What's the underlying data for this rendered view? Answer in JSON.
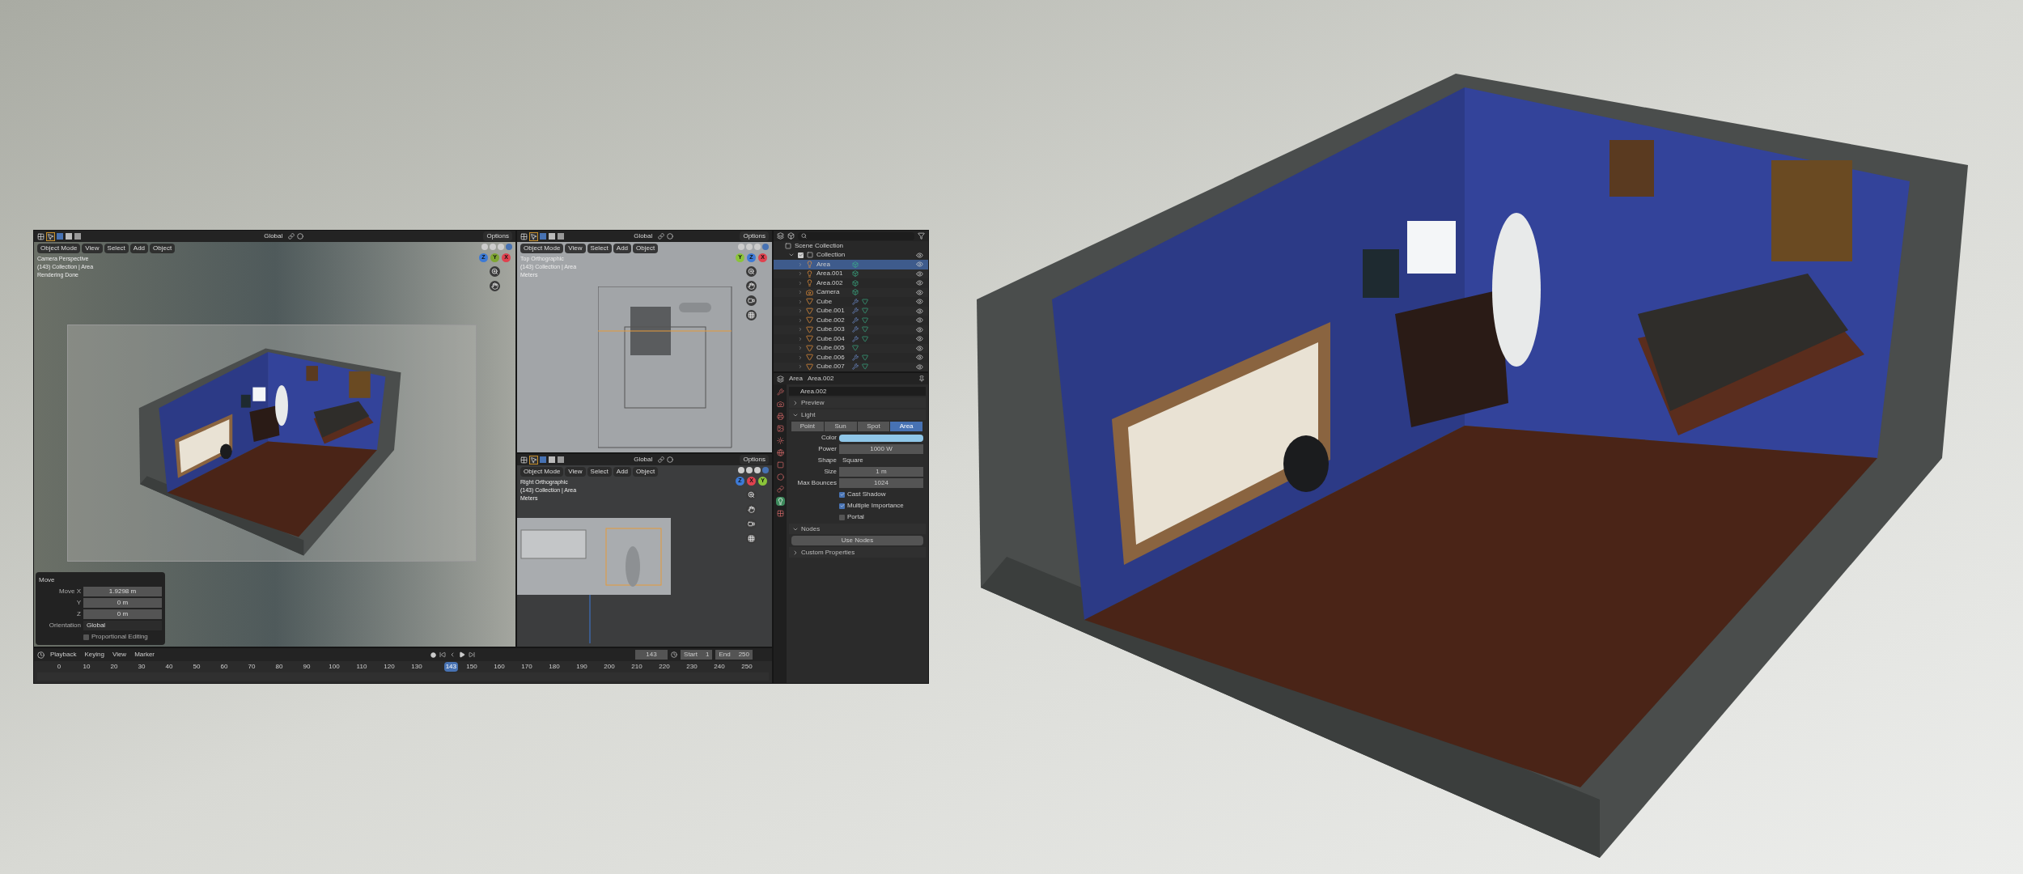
{
  "viewports": [
    {
      "kind": "camera",
      "orientation": "Global",
      "options": "Options",
      "menus": [
        "Object Mode",
        "View",
        "Select",
        "Add",
        "Object"
      ],
      "overlay_text": [
        "Camera Perspective",
        "(143) Collection | Area",
        "Rendering Done"
      ],
      "gizmo": [
        {
          "label": "Z",
          "color": "#3d7ad6"
        },
        {
          "label": "Y",
          "color": "#7fa632"
        },
        {
          "label": "X",
          "color": "#e0424f"
        }
      ]
    },
    {
      "kind": "top",
      "orientation": "Global",
      "options": "Options",
      "menus": [
        "Object Mode",
        "View",
        "Select",
        "Add",
        "Object"
      ],
      "overlay_text": [
        "Top Orthographic",
        "(143) Collection | Area",
        "Meters"
      ],
      "gizmo": [
        {
          "label": "Y",
          "color": "#8bc43a"
        },
        {
          "label": "Z",
          "color": "#3d7ad6"
        },
        {
          "label": "X",
          "color": "#e0424f"
        }
      ]
    },
    {
      "kind": "right",
      "orientation": "Global",
      "options": "Options",
      "menus": [
        "Object Mode",
        "View",
        "Select",
        "Add",
        "Object"
      ],
      "overlay_text": [
        "Right Orthographic",
        "(143) Collection | Area",
        "Meters"
      ],
      "gizmo": [
        {
          "label": "Z",
          "color": "#3d7ad6"
        },
        {
          "label": "X",
          "color": "#e0424f"
        },
        {
          "label": "Y",
          "color": "#8bc43a"
        }
      ]
    }
  ],
  "move_panel": {
    "title": "Move",
    "fields": [
      {
        "label": "Move X",
        "value": "1.9298 m"
      },
      {
        "label": "Y",
        "value": "0 m"
      },
      {
        "label": "Z",
        "value": "0 m"
      }
    ],
    "orientation_label": "Orientation",
    "orientation": "Global",
    "proportional": {
      "label": "Proportional Editing",
      "checked": false
    }
  },
  "timeline": {
    "menus": [
      "Playback",
      "Keying",
      "View",
      "Marker"
    ],
    "current_frame": "143",
    "marker_frame": "143",
    "start_label": "Start",
    "start": "1",
    "end_label": "End",
    "end": "250",
    "ticks": [
      "0",
      "10",
      "20",
      "30",
      "40",
      "50",
      "60",
      "70",
      "80",
      "90",
      "100",
      "110",
      "120",
      "130",
      "150",
      "160",
      "170",
      "180",
      "190",
      "200",
      "210",
      "220",
      "230",
      "240",
      "250"
    ]
  },
  "outliner": {
    "scene": "Scene Collection",
    "collection": {
      "name": "Collection",
      "checked": true,
      "expanded": true,
      "children": [
        {
          "name": "Area",
          "kind": "light",
          "selected": true,
          "modifier": false
        },
        {
          "name": "Area.001",
          "kind": "light",
          "selected": false,
          "modifier": false
        },
        {
          "name": "Area.002",
          "kind": "light",
          "selected": false,
          "modifier": false
        },
        {
          "name": "Camera",
          "kind": "camera",
          "selected": false,
          "modifier": false
        },
        {
          "name": "Cube",
          "kind": "mesh",
          "selected": false,
          "modifier": true
        },
        {
          "name": "Cube.001",
          "kind": "mesh",
          "selected": false,
          "modifier": true
        },
        {
          "name": "Cube.002",
          "kind": "mesh",
          "selected": false,
          "modifier": true
        },
        {
          "name": "Cube.003",
          "kind": "mesh",
          "selected": false,
          "modifier": true
        },
        {
          "name": "Cube.004",
          "kind": "mesh",
          "selected": false,
          "modifier": true
        },
        {
          "name": "Cube.005",
          "kind": "mesh",
          "selected": false,
          "modifier": false
        },
        {
          "name": "Cube.006",
          "kind": "mesh",
          "selected": false,
          "modifier": true
        },
        {
          "name": "Cube.007",
          "kind": "mesh",
          "selected": false,
          "modifier": true
        }
      ]
    }
  },
  "properties": {
    "object": "Area",
    "data": "Area.002",
    "datablock": "Area.002",
    "tabs": [
      {
        "kind": "tool",
        "selected": false
      },
      {
        "kind": "render",
        "selected": false
      },
      {
        "kind": "output",
        "selected": false
      },
      {
        "kind": "view_layer",
        "selected": false
      },
      {
        "kind": "scene",
        "selected": false
      },
      {
        "kind": "world",
        "selected": false
      },
      {
        "kind": "object",
        "selected": false
      },
      {
        "kind": "physics",
        "selected": false
      },
      {
        "kind": "constraints",
        "selected": false
      },
      {
        "kind": "light",
        "selected": true
      },
      {
        "kind": "texture",
        "selected": false
      }
    ],
    "preview": {
      "title": "Preview",
      "expanded": false
    },
    "light": {
      "title": "Light",
      "expanded": true,
      "types": [
        {
          "label": "Point",
          "selected": false
        },
        {
          "label": "Sun",
          "selected": false
        },
        {
          "label": "Spot",
          "selected": false
        },
        {
          "label": "Area",
          "selected": true
        }
      ],
      "color_label": "Color",
      "color": "#8fc6e8",
      "fields": [
        {
          "label": "Power",
          "value": "1000 W",
          "kind": "number"
        },
        {
          "label": "Shape",
          "value": "Square",
          "kind": "dropdown"
        },
        {
          "label": "Size",
          "value": "1 m",
          "kind": "number"
        },
        {
          "label": "Max Bounces",
          "value": "1024",
          "kind": "number"
        }
      ],
      "checks": [
        {
          "label": "Cast Shadow",
          "checked": true
        },
        {
          "label": "Multiple Importance",
          "checked": true
        },
        {
          "label": "Portal",
          "checked": false
        }
      ]
    },
    "nodes": {
      "title": "Nodes",
      "expanded": true,
      "button": "Use Nodes"
    },
    "custom": {
      "title": "Custom Properties",
      "expanded": false
    }
  }
}
